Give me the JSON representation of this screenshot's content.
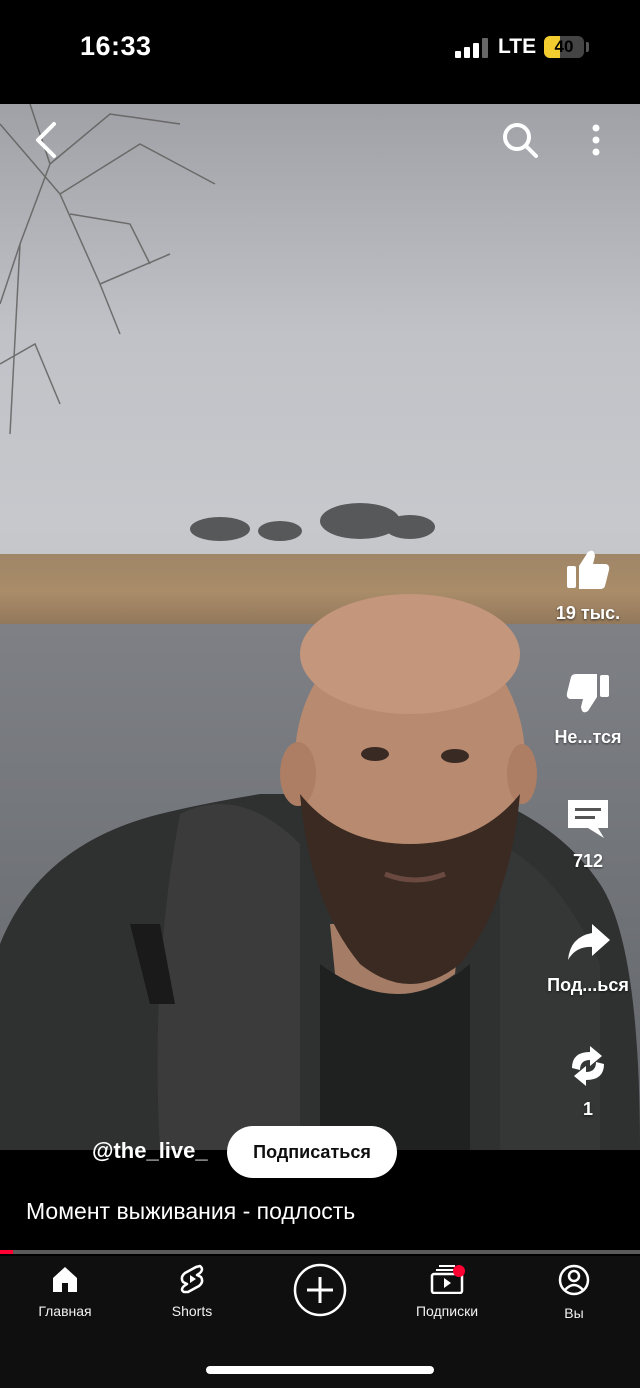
{
  "status_bar": {
    "time": "16:33",
    "network": "LTE",
    "battery_level": "40",
    "battery_fraction": 0.4,
    "signal_bars_active": 3,
    "signal_bars_total": 4
  },
  "top_bar": {
    "back_icon": "chevron-left-icon",
    "search_icon": "search-icon",
    "more_icon": "more-vertical-icon"
  },
  "actions": {
    "like": {
      "icon": "thumbs-up-icon",
      "label": "19 тыс."
    },
    "dislike": {
      "icon": "thumbs-down-icon",
      "label": "Не...тся"
    },
    "comments": {
      "icon": "comment-icon",
      "label": "712"
    },
    "share": {
      "icon": "share-icon",
      "label": "Под...ься"
    },
    "remix": {
      "icon": "remix-icon",
      "label": "1"
    }
  },
  "video_info": {
    "channel": "@the_live_",
    "subscribe_label": "Подписаться",
    "title": "Момент выживания - подлость"
  },
  "progress": {
    "played_fraction": 0.02,
    "played_color": "#ff0033"
  },
  "bottom_nav": {
    "items": [
      {
        "icon": "home-icon",
        "label": "Главная"
      },
      {
        "icon": "shorts-icon",
        "label": "Shorts"
      },
      {
        "icon": "create-plus-icon",
        "label": ""
      },
      {
        "icon": "subscriptions-icon",
        "label": "Подписки"
      },
      {
        "icon": "account-icon",
        "label": "Вы"
      }
    ]
  }
}
